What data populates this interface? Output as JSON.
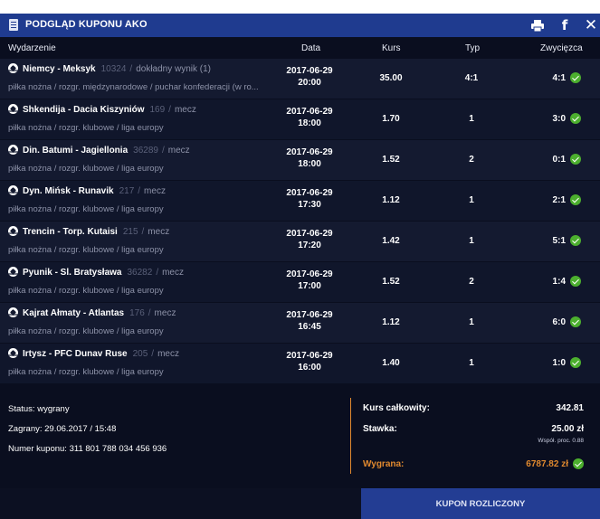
{
  "window": {
    "title": "PODGLĄD KUPONU AKO"
  },
  "columns": {
    "event": "Wydarzenie",
    "date": "Data",
    "odds": "Kurs",
    "type": "Typ",
    "winner": "Zwycięzca"
  },
  "rows": [
    {
      "match": "Niemcy - Meksyk",
      "id": "10324",
      "market": "dokładny wynik (1)",
      "crumbs": "piłka nożna / rozgr. międzynarodowe / puchar konfederacji (w ro...",
      "date": "2017-06-29",
      "time": "20:00",
      "odds": "35.00",
      "type": "4:1",
      "winner": "4:1"
    },
    {
      "match": "Shkendija - Dacia Kiszyniów",
      "id": "169",
      "market": "mecz",
      "crumbs": "piłka nożna / rozgr. klubowe / liga europy",
      "date": "2017-06-29",
      "time": "18:00",
      "odds": "1.70",
      "type": "1",
      "winner": "3:0"
    },
    {
      "match": "Din. Batumi - Jagiellonia",
      "id": "36289",
      "market": "mecz",
      "crumbs": "piłka nożna / rozgr. klubowe / liga europy",
      "date": "2017-06-29",
      "time": "18:00",
      "odds": "1.52",
      "type": "2",
      "winner": "0:1"
    },
    {
      "match": "Dyn. Mińsk - Runavik",
      "id": "217",
      "market": "mecz",
      "crumbs": "piłka nożna / rozgr. klubowe / liga europy",
      "date": "2017-06-29",
      "time": "17:30",
      "odds": "1.12",
      "type": "1",
      "winner": "2:1"
    },
    {
      "match": "Trencin - Torp. Kutaisi",
      "id": "215",
      "market": "mecz",
      "crumbs": "piłka nożna / rozgr. klubowe / liga europy",
      "date": "2017-06-29",
      "time": "17:20",
      "odds": "1.42",
      "type": "1",
      "winner": "5:1"
    },
    {
      "match": "Pyunik - Sl. Bratysława",
      "id": "36282",
      "market": "mecz",
      "crumbs": "piłka nożna / rozgr. klubowe / liga europy",
      "date": "2017-06-29",
      "time": "17:00",
      "odds": "1.52",
      "type": "2",
      "winner": "1:4"
    },
    {
      "match": "Kajrat Ałmaty - Atlantas",
      "id": "176",
      "market": "mecz",
      "crumbs": "piłka nożna / rozgr. klubowe / liga europy",
      "date": "2017-06-29",
      "time": "16:45",
      "odds": "1.12",
      "type": "1",
      "winner": "6:0"
    },
    {
      "match": "Irtysz - PFC Dunav Ruse",
      "id": "205",
      "market": "mecz",
      "crumbs": "piłka nożna / rozgr. klubowe / liga europy",
      "date": "2017-06-29",
      "time": "16:00",
      "odds": "1.40",
      "type": "1",
      "winner": "1:0"
    }
  ],
  "summary": {
    "status": "Status: wygrany",
    "placed": "Zagrany: 29.06.2017 / 15:48",
    "coupon_number": "Numer kuponu: 311 801 788 034 456 936",
    "total_odds_label": "Kurs całkowity:",
    "total_odds_value": "342.81",
    "stake_label": "Stawka:",
    "stake_value": "25.00 zł",
    "proc_note": "Współ. proc. 0.88",
    "win_label": "Wygrana:",
    "win_value": "6787.82 zł"
  },
  "footer": {
    "button": "KUPON ROZLICZONY"
  },
  "colors": {
    "header_blue": "#1f3b8f",
    "background": "#0a0e1f",
    "accent_orange": "#e0892f",
    "success_green": "#4caf2e"
  }
}
